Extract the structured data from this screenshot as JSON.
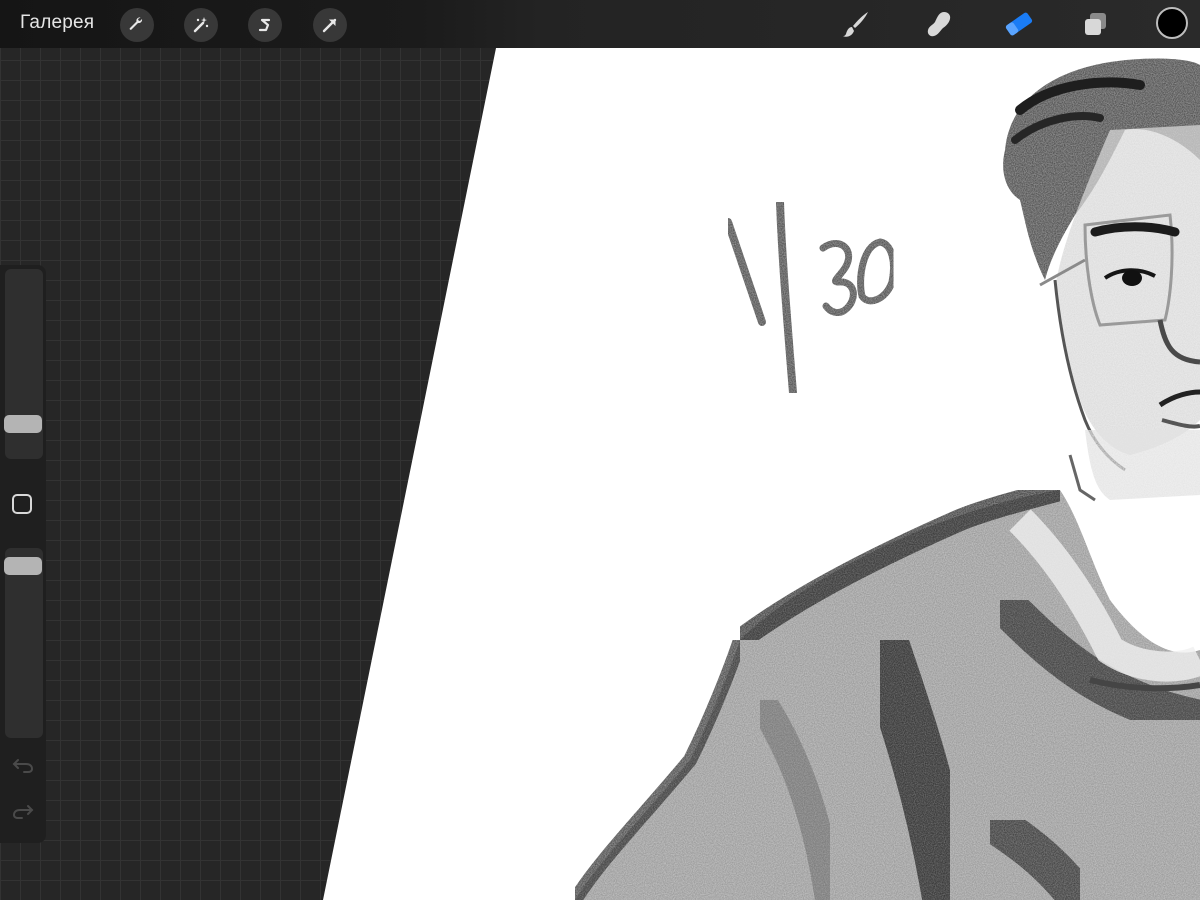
{
  "toolbar": {
    "gallery_label": "Галерея",
    "left_tools": [
      {
        "name": "actions",
        "icon": "wrench-icon"
      },
      {
        "name": "adjustments",
        "icon": "magic-wand-icon"
      },
      {
        "name": "selection",
        "icon": "selection-s-icon"
      },
      {
        "name": "transform",
        "icon": "arrow-cursor-icon"
      }
    ],
    "right_tools": [
      {
        "name": "brush",
        "icon": "brush-icon",
        "active": false
      },
      {
        "name": "smudge",
        "icon": "smudge-finger-icon",
        "active": false
      },
      {
        "name": "eraser",
        "icon": "eraser-icon",
        "active": true
      },
      {
        "name": "layers",
        "icon": "layers-icon",
        "active": false
      }
    ],
    "current_color": "#000000",
    "active_color": "#1a7cf5"
  },
  "sidebar": {
    "brush_size_level": 0.15,
    "opacity_level": 0.95,
    "modify_icon": "square-outline-icon",
    "undo_icon": "undo-icon",
    "redo_icon": "redo-icon"
  },
  "canvas": {
    "handwritten_text": "1/30"
  }
}
